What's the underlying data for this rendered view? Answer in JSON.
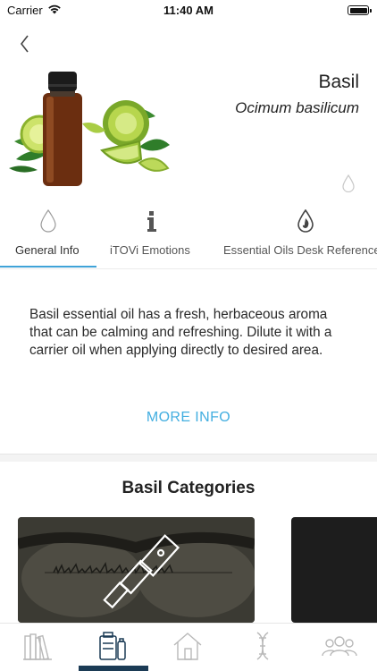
{
  "status_bar": {
    "carrier": "Carrier",
    "time": "11:40 AM"
  },
  "header": {
    "name": "Basil",
    "latin": "Ocimum basilicum"
  },
  "tabs": [
    {
      "label": "General Info",
      "icon": "drop-outline-icon",
      "active": true
    },
    {
      "label": "iTOVi Emotions",
      "icon": "info-icon",
      "active": false
    },
    {
      "label": "Essential Oils Desk Reference",
      "icon": "drop-flame-icon",
      "active": false
    }
  ],
  "description": "Basil essential oil has a fresh, herbaceous aroma that can be calming and refreshing. Dilute it with a carrier oil when applying directly to desired area.",
  "more_info": "MORE INFO",
  "categories": {
    "title": "Basil Categories"
  },
  "bottom_nav": [
    {
      "icon": "library-books-icon",
      "active": false
    },
    {
      "icon": "oils-catalog-icon",
      "active": true
    },
    {
      "icon": "home-icon",
      "active": false
    },
    {
      "icon": "dna-icon",
      "active": false
    },
    {
      "icon": "community-icon",
      "active": false
    }
  ],
  "colors": {
    "accent": "#43aee0",
    "nav_active": "#1b3b55"
  }
}
